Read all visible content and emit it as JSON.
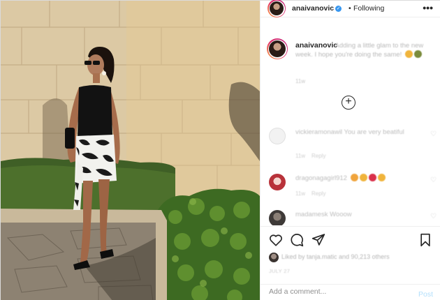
{
  "post": {
    "username": "anaivanovic",
    "separator": "•",
    "follow_label": "Following",
    "more_label": "•••",
    "image_alt": "photo of a woman in a black top and patterned skirt standing before a stone wall"
  },
  "caption": {
    "username": "anaivanovic",
    "text": "Adding a little glam to the new week. I hope you're doing the same!",
    "time": "11w"
  },
  "load_more": {
    "label": "+"
  },
  "comments": [
    {
      "username": "vickieramonawil",
      "text": "You are very beatiful",
      "time": "11w",
      "reply_label": "Reply",
      "avatar_color": "#eeeeee"
    },
    {
      "username": "dragonagagirl912",
      "text": "",
      "time": "11w",
      "reply_label": "Reply",
      "avatar_color": "#c03a3a"
    },
    {
      "username": "madamesk",
      "text": "Wooow",
      "time": "",
      "reply_label": "",
      "avatar_color": "#5a5a5a"
    }
  ],
  "actions": {
    "like_icon": "heart-icon",
    "comment_icon": "comment-icon",
    "share_icon": "share-icon",
    "save_icon": "bookmark-icon"
  },
  "likes": {
    "text": "Liked by tanja.matic and 90,213 others"
  },
  "date": "JULY 27",
  "add_comment": {
    "placeholder": "Add a comment...",
    "post_label": "Post"
  },
  "colors": {
    "accent": "#3897f0",
    "post_disabled": "#b2dffc",
    "border": "#dbdbdb"
  }
}
